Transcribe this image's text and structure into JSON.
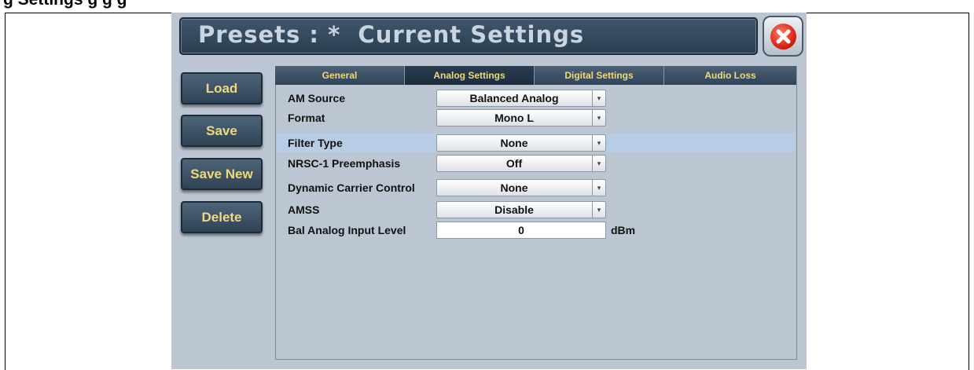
{
  "document": {
    "caption_fragment": "g                    Settings  g    g    g"
  },
  "title": {
    "prefix": "Presets",
    "separator": " : * ",
    "name": "Current Settings",
    "full": "Presets : *  Current Settings"
  },
  "close_icon": "close-x-icon",
  "sidebar": {
    "buttons": [
      {
        "label": "Load"
      },
      {
        "label": "Save"
      },
      {
        "label": "Save New"
      },
      {
        "label": "Delete"
      }
    ]
  },
  "tabs": [
    {
      "label": "General",
      "active": false
    },
    {
      "label": "Analog Settings",
      "active": true
    },
    {
      "label": "Digital Settings",
      "active": false
    },
    {
      "label": "Audio Loss",
      "active": false
    }
  ],
  "rows": [
    {
      "label": "AM Source",
      "value": "Balanced Analog",
      "kind": "dropdown",
      "highlight": false
    },
    {
      "label": "Format",
      "value": "Mono L",
      "kind": "dropdown",
      "highlight": false
    },
    {
      "label": "Filter Type",
      "value": "None",
      "kind": "dropdown",
      "highlight": true
    },
    {
      "label": "NRSC-1 Preemphasis",
      "value": "Off",
      "kind": "dropdown",
      "highlight": false
    },
    {
      "label": "Dynamic Carrier Control",
      "value": "None",
      "kind": "dropdown",
      "highlight": false
    },
    {
      "label": "AMSS",
      "value": "Disable",
      "kind": "dropdown",
      "highlight": false
    },
    {
      "label": "Bal Analog Input Level",
      "value": "0",
      "kind": "text",
      "unit": "dBm",
      "highlight": false
    }
  ],
  "dropdown_arrow": "▾",
  "colors": {
    "button_text": "#f1d97a",
    "title_text": "#c8d4df",
    "highlight_row": "#b7cde6"
  }
}
